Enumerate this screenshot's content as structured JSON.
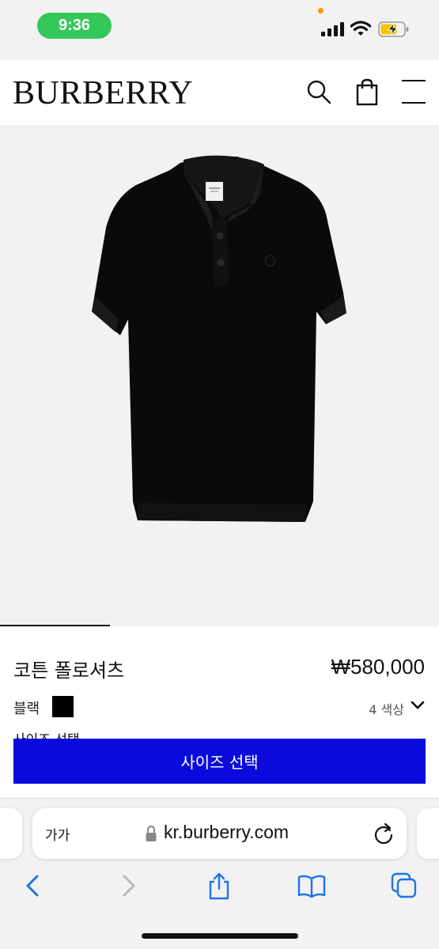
{
  "status_bar": {
    "time": "9:36",
    "signal_icon": "cellular-signal-icon",
    "wifi_icon": "wifi-icon",
    "battery_icon": "battery-charging-icon",
    "time_pill_color": "#34c759"
  },
  "header": {
    "logo": "BURBERRY",
    "search_icon": "search-icon",
    "bag_icon": "shopping-bag-icon",
    "menu_icon": "hamburger-menu-icon"
  },
  "product": {
    "name": "코튼 폴로셔츠",
    "price": "₩580,000",
    "color_label": "블랙",
    "color_swatch": "#000000",
    "color_count": "4 색상",
    "size_peek_label": "사이즈 선택",
    "size_button_label": "사이즈 선택",
    "size_button_color": "#0a0adc",
    "image_subject": "black short-sleeve polo shirt"
  },
  "browser": {
    "aa_label": "가가",
    "url": "kr.burberry.com",
    "nav_icons": [
      "back-icon",
      "forward-icon",
      "share-icon",
      "bookmarks-icon",
      "tabs-icon"
    ]
  }
}
